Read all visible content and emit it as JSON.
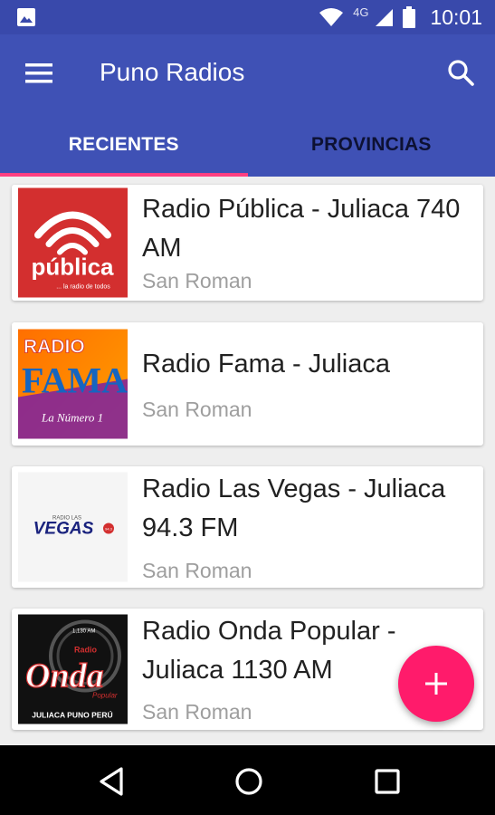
{
  "status_bar": {
    "time": "10:01",
    "network": "4G",
    "icons": [
      "image-notification-icon",
      "wifi-icon",
      "cell-signal-icon",
      "battery-icon"
    ]
  },
  "app_bar": {
    "title": "Puno Radios",
    "menu_icon": "menu-icon",
    "search_icon": "search-icon"
  },
  "tabs": [
    {
      "label": "RECIENTES",
      "active": true
    },
    {
      "label": "PROVINCIAS",
      "active": false
    }
  ],
  "stations": [
    {
      "name": "Radio Pública - Juliaca 740 AM",
      "province": "San Roman",
      "logo_text": [
        "pública",
        "... la radio de todos"
      ]
    },
    {
      "name": "Radio Fama - Juliaca",
      "province": "San Roman",
      "logo_text": [
        "RADIO",
        "FAMA",
        "La Número 1"
      ]
    },
    {
      "name": "Radio Las Vegas - Juliaca 94.3 FM",
      "province": "San Roman",
      "logo_text": [
        "RADIO LAS",
        "VEGAS",
        "94.3"
      ]
    },
    {
      "name": "Radio Onda Popular - Juliaca 1130 AM",
      "province": "San Roman",
      "logo_text": [
        "1,130 AM",
        "Radio",
        "Onda",
        "Popular",
        "JULIACA PUNO PERÚ"
      ]
    }
  ],
  "fab": {
    "icon": "plus-icon"
  },
  "nav_bar": {
    "icons": [
      "back-icon",
      "home-icon",
      "recents-icon"
    ]
  },
  "colors": {
    "primary": "#3f51b5",
    "primary_dark": "#3949ab",
    "accent": "#ff4081",
    "fab": "#ff1b6b"
  }
}
